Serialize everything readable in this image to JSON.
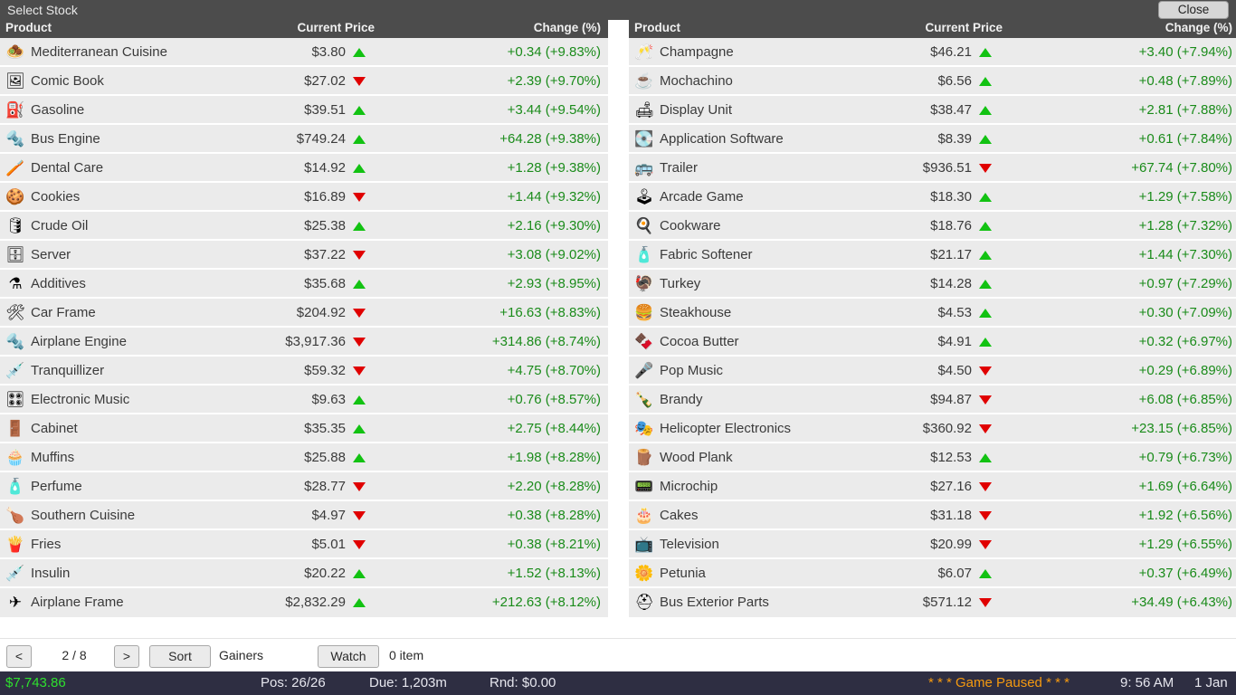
{
  "window": {
    "title": "Select Stock",
    "close_label": "Close"
  },
  "columns": {
    "product": "Product",
    "price": "Current Price",
    "change": "Change (%)"
  },
  "colors": {
    "up_arrow": "#12c212",
    "down_arrow": "#e00000",
    "change_text": "#1a8b1a",
    "header_bg": "#4c4c4c",
    "row_bg": "#ebebeb",
    "statusbar_bg": "#2e2e42",
    "cash_text": "#2ee02e",
    "paused_text": "#f59a10"
  },
  "left_panel": {
    "rows": [
      {
        "icon": "🧆",
        "icon_name": "mediterranean-cuisine-icon",
        "name": "Mediterranean Cuisine",
        "price": "$3.80",
        "arrow": "up",
        "change": "+0.34 (+9.83%)"
      },
      {
        "icon": "🖼",
        "icon_name": "comic-book-icon",
        "name": "Comic Book",
        "price": "$27.02",
        "arrow": "down",
        "change": "+2.39 (+9.70%)"
      },
      {
        "icon": "⛽",
        "icon_name": "gasoline-icon",
        "name": "Gasoline",
        "price": "$39.51",
        "arrow": "up",
        "change": "+3.44 (+9.54%)"
      },
      {
        "icon": "🔩",
        "icon_name": "bus-engine-icon",
        "name": "Bus Engine",
        "price": "$749.24",
        "arrow": "up",
        "change": "+64.28 (+9.38%)"
      },
      {
        "icon": "🪥",
        "icon_name": "dental-care-icon",
        "name": "Dental Care",
        "price": "$14.92",
        "arrow": "up",
        "change": "+1.28 (+9.38%)"
      },
      {
        "icon": "🍪",
        "icon_name": "cookies-icon",
        "name": "Cookies",
        "price": "$16.89",
        "arrow": "down",
        "change": "+1.44 (+9.32%)"
      },
      {
        "icon": "🛢",
        "icon_name": "crude-oil-icon",
        "name": "Crude Oil",
        "price": "$25.38",
        "arrow": "up",
        "change": "+2.16 (+9.30%)"
      },
      {
        "icon": "🗄",
        "icon_name": "server-icon",
        "name": "Server",
        "price": "$37.22",
        "arrow": "down",
        "change": "+3.08 (+9.02%)"
      },
      {
        "icon": "⚗",
        "icon_name": "additives-icon",
        "name": "Additives",
        "price": "$35.68",
        "arrow": "up",
        "change": "+2.93 (+8.95%)"
      },
      {
        "icon": "🛠",
        "icon_name": "car-frame-icon",
        "name": "Car Frame",
        "price": "$204.92",
        "arrow": "down",
        "change": "+16.63 (+8.83%)"
      },
      {
        "icon": "🔩",
        "icon_name": "airplane-engine-icon",
        "name": "Airplane Engine",
        "price": "$3,917.36",
        "arrow": "down",
        "change": "+314.86 (+8.74%)"
      },
      {
        "icon": "💉",
        "icon_name": "tranquillizer-icon",
        "name": "Tranquillizer",
        "price": "$59.32",
        "arrow": "down",
        "change": "+4.75 (+8.70%)"
      },
      {
        "icon": "🎛",
        "icon_name": "electronic-music-icon",
        "name": "Electronic Music",
        "price": "$9.63",
        "arrow": "up",
        "change": "+0.76 (+8.57%)"
      },
      {
        "icon": "🚪",
        "icon_name": "cabinet-icon",
        "name": "Cabinet",
        "price": "$35.35",
        "arrow": "up",
        "change": "+2.75 (+8.44%)"
      },
      {
        "icon": "🧁",
        "icon_name": "muffins-icon",
        "name": "Muffins",
        "price": "$25.88",
        "arrow": "up",
        "change": "+1.98 (+8.28%)"
      },
      {
        "icon": "🧴",
        "icon_name": "perfume-icon",
        "name": "Perfume",
        "price": "$28.77",
        "arrow": "down",
        "change": "+2.20 (+8.28%)"
      },
      {
        "icon": "🍗",
        "icon_name": "southern-cuisine-icon",
        "name": "Southern Cuisine",
        "price": "$4.97",
        "arrow": "down",
        "change": "+0.38 (+8.28%)"
      },
      {
        "icon": "🍟",
        "icon_name": "fries-icon",
        "name": "Fries",
        "price": "$5.01",
        "arrow": "down",
        "change": "+0.38 (+8.21%)"
      },
      {
        "icon": "💉",
        "icon_name": "insulin-icon",
        "name": "Insulin",
        "price": "$20.22",
        "arrow": "up",
        "change": "+1.52 (+8.13%)"
      },
      {
        "icon": "✈",
        "icon_name": "airplane-frame-icon",
        "name": "Airplane Frame",
        "price": "$2,832.29",
        "arrow": "up",
        "change": "+212.63 (+8.12%)"
      }
    ]
  },
  "right_panel": {
    "rows": [
      {
        "icon": "🥂",
        "icon_name": "champagne-icon",
        "name": "Champagne",
        "price": "$46.21",
        "arrow": "up",
        "change": "+3.40 (+7.94%)"
      },
      {
        "icon": "☕",
        "icon_name": "mochachino-icon",
        "name": "Mochachino",
        "price": "$6.56",
        "arrow": "up",
        "change": "+0.48 (+7.89%)"
      },
      {
        "icon": "🛋",
        "icon_name": "display-unit-icon",
        "name": "Display Unit",
        "price": "$38.47",
        "arrow": "up",
        "change": "+2.81 (+7.88%)"
      },
      {
        "icon": "💽",
        "icon_name": "application-software-icon",
        "name": "Application Software",
        "price": "$8.39",
        "arrow": "up",
        "change": "+0.61 (+7.84%)"
      },
      {
        "icon": "🚌",
        "icon_name": "trailer-icon",
        "name": "Trailer",
        "price": "$936.51",
        "arrow": "down",
        "change": "+67.74 (+7.80%)"
      },
      {
        "icon": "🕹",
        "icon_name": "arcade-game-icon",
        "name": "Arcade Game",
        "price": "$18.30",
        "arrow": "up",
        "change": "+1.29 (+7.58%)"
      },
      {
        "icon": "🍳",
        "icon_name": "cookware-icon",
        "name": "Cookware",
        "price": "$18.76",
        "arrow": "up",
        "change": "+1.28 (+7.32%)"
      },
      {
        "icon": "🧴",
        "icon_name": "fabric-softener-icon",
        "name": "Fabric Softener",
        "price": "$21.17",
        "arrow": "up",
        "change": "+1.44 (+7.30%)"
      },
      {
        "icon": "🦃",
        "icon_name": "turkey-icon",
        "name": "Turkey",
        "price": "$14.28",
        "arrow": "up",
        "change": "+0.97 (+7.29%)"
      },
      {
        "icon": "🍔",
        "icon_name": "steakhouse-icon",
        "name": "Steakhouse",
        "price": "$4.53",
        "arrow": "up",
        "change": "+0.30 (+7.09%)"
      },
      {
        "icon": "🍫",
        "icon_name": "cocoa-butter-icon",
        "name": "Cocoa Butter",
        "price": "$4.91",
        "arrow": "up",
        "change": "+0.32 (+6.97%)"
      },
      {
        "icon": "🎤",
        "icon_name": "pop-music-icon",
        "name": "Pop Music",
        "price": "$4.50",
        "arrow": "down",
        "change": "+0.29 (+6.89%)"
      },
      {
        "icon": "🍾",
        "icon_name": "brandy-icon",
        "name": "Brandy",
        "price": "$94.87",
        "arrow": "down",
        "change": "+6.08 (+6.85%)"
      },
      {
        "icon": "🎭",
        "icon_name": "helicopter-electronics-icon",
        "name": "Helicopter Electronics",
        "price": "$360.92",
        "arrow": "down",
        "change": "+23.15 (+6.85%)"
      },
      {
        "icon": "🪵",
        "icon_name": "wood-plank-icon",
        "name": "Wood Plank",
        "price": "$12.53",
        "arrow": "up",
        "change": "+0.79 (+6.73%)"
      },
      {
        "icon": "📟",
        "icon_name": "microchip-icon",
        "name": "Microchip",
        "price": "$27.16",
        "arrow": "down",
        "change": "+1.69 (+6.64%)"
      },
      {
        "icon": "🎂",
        "icon_name": "cakes-icon",
        "name": "Cakes",
        "price": "$31.18",
        "arrow": "down",
        "change": "+1.92 (+6.56%)"
      },
      {
        "icon": "📺",
        "icon_name": "television-icon",
        "name": "Television",
        "price": "$20.99",
        "arrow": "down",
        "change": "+1.29 (+6.55%)"
      },
      {
        "icon": "🌼",
        "icon_name": "petunia-icon",
        "name": "Petunia",
        "price": "$6.07",
        "arrow": "up",
        "change": "+0.37 (+6.49%)"
      },
      {
        "icon": "⛑",
        "icon_name": "bus-exterior-parts-icon",
        "name": "Bus Exterior Parts",
        "price": "$571.12",
        "arrow": "down",
        "change": "+34.49 (+6.43%)"
      }
    ]
  },
  "toolbar": {
    "prev_label": "<",
    "page_label": "2 / 8",
    "next_label": ">",
    "sort_label": "Sort",
    "sort_mode": "Gainers",
    "watch_label": "Watch",
    "watch_count": "0 item"
  },
  "statusbar": {
    "cash": "$7,743.86",
    "positions": "Pos: 26/26",
    "due": "Due: 1,203m",
    "round": "Rnd: $0.00",
    "paused": "* * * Game Paused * * *",
    "time": "9: 56 AM",
    "date": "1 Jan"
  }
}
